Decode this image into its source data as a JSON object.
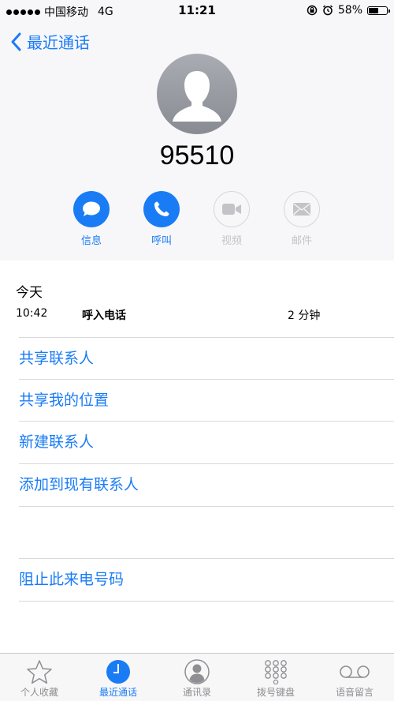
{
  "status_bar": {
    "carrier": "中国移动",
    "network": "4G",
    "time": "11:21",
    "battery": "58%",
    "battery_level": 0.58
  },
  "nav": {
    "back_label": "最近通话"
  },
  "contact": {
    "number": "95510"
  },
  "actions": [
    {
      "label": "信息",
      "icon": "message-icon",
      "enabled": true
    },
    {
      "label": "呼叫",
      "icon": "phone-icon",
      "enabled": true
    },
    {
      "label": "视频",
      "icon": "video-icon",
      "enabled": false
    },
    {
      "label": "邮件",
      "icon": "mail-icon",
      "enabled": false
    }
  ],
  "recents": {
    "section": "今天",
    "call": {
      "time": "10:42",
      "type": "呼入电话",
      "duration": "2 分钟"
    }
  },
  "menu": {
    "share_contact": "共享联系人",
    "share_location": "共享我的位置",
    "new_contact": "新建联系人",
    "add_existing": "添加到现有联系人",
    "block": "阻止此来电号码"
  },
  "tabbar": [
    {
      "label": "个人收藏",
      "icon": "star-icon"
    },
    {
      "label": "最近通话",
      "icon": "clock-icon",
      "active": true
    },
    {
      "label": "通讯录",
      "icon": "contacts-icon"
    },
    {
      "label": "拨号键盘",
      "icon": "keypad-icon"
    },
    {
      "label": "语音留言",
      "icon": "voicemail-icon"
    }
  ],
  "colors": {
    "accent": "#1a7cf5",
    "header_bg": "#f7f7fa",
    "disabled": "#c3c3c8"
  }
}
